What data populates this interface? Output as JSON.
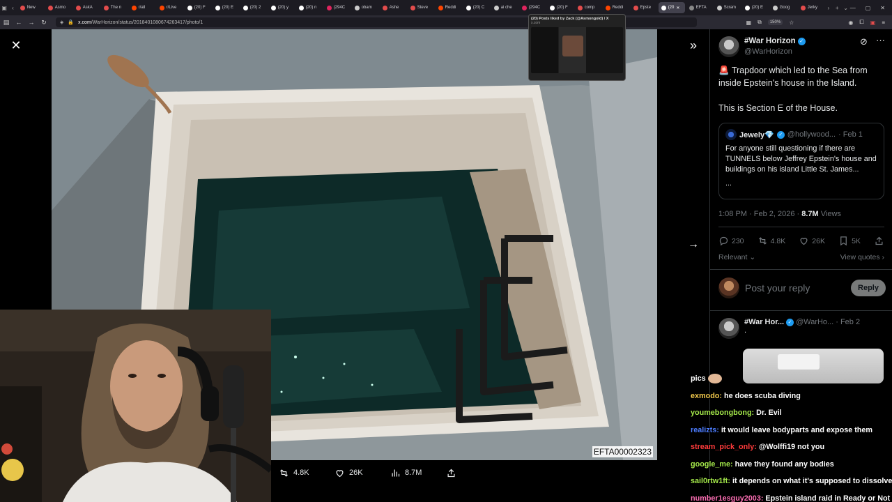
{
  "browser": {
    "tabs": [
      {
        "label": "New",
        "color": "#e34c4c"
      },
      {
        "label": "Asmo",
        "color": "#e34c4c"
      },
      {
        "label": "AskA",
        "color": "#e34c4c"
      },
      {
        "label": "The n",
        "color": "#e34c4c"
      },
      {
        "label": "r/all",
        "color": "#ff4500"
      },
      {
        "label": "r/Live",
        "color": "#ff4500"
      },
      {
        "label": "(20) F",
        "color": "#ffffff"
      },
      {
        "label": "(20) E",
        "color": "#ffffff"
      },
      {
        "label": "(20) 2",
        "color": "#ffffff"
      },
      {
        "label": "(20) y",
        "color": "#ffffff"
      },
      {
        "label": "(20) n",
        "color": "#ffffff"
      },
      {
        "label": "(294C",
        "color": "#e0245e"
      },
      {
        "label": "obam",
        "color": "#cccccc"
      },
      {
        "label": "Ashe",
        "color": "#e34c4c"
      },
      {
        "label": "Steve",
        "color": "#e34c4c"
      },
      {
        "label": "Reddi",
        "color": "#ff4500"
      },
      {
        "label": "(20) C",
        "color": "#ffffff"
      },
      {
        "label": "ai che",
        "color": "#cccccc"
      },
      {
        "label": "(294C",
        "color": "#e0245e"
      },
      {
        "label": "(20) F",
        "color": "#ffffff"
      },
      {
        "label": "comp",
        "color": "#e34c4c"
      },
      {
        "label": "Reddi",
        "color": "#ff4500"
      },
      {
        "label": "Epste",
        "color": "#e34c4c"
      },
      {
        "label": "(20",
        "color": "#ffffff"
      },
      {
        "label": "EFTA",
        "color": "#888888"
      },
      {
        "label": "Scram",
        "color": "#cccccc"
      },
      {
        "label": "(20) E",
        "color": "#ffffff"
      },
      {
        "label": "Goog",
        "color": "#cccccc"
      },
      {
        "label": "Jerky",
        "color": "#e34c4c"
      }
    ],
    "active_tab_index": 23,
    "url_host": "x.com",
    "url_path": "/WarHorizon/status/2018401080674263417/photo/1",
    "zoom": "150%",
    "preview": {
      "title": "(20) Posts liked by Zack (@Asmongold) / X",
      "host": "x.com"
    }
  },
  "photo": {
    "id_label": "EFTA00002323",
    "actions": {
      "retweets": "4.8K",
      "likes": "26K",
      "views": "8.7M"
    }
  },
  "tweet": {
    "author_name": "#War Horizon",
    "author_handle": "@WarHorizon",
    "text_line1": "Trapdoor which led to the Sea from inside Epstein's house in the Island.",
    "siren": "🚨",
    "text_line2": "This is Section E of the House.",
    "quote": {
      "name": "Jewely💎",
      "handle": "@hollywood...",
      "date": "· Feb 1",
      "text": "For anyone still questioning if there are TUNNELS below Jeffrey Epstein's house and buildings on his island Little St. James...",
      "ellipsis": "..."
    },
    "time": "1:08 PM · Feb 2, 2026 · ",
    "views_count": "8.7M",
    "views_label": " Views",
    "stats": {
      "replies": "230",
      "retweets": "4.8K",
      "likes": "26K",
      "bookmarks": "5K"
    },
    "relevant_label": "Relevant",
    "view_quotes_label": "View quotes",
    "reply_placeholder": "Post your reply",
    "reply_button": "Reply",
    "reply2": {
      "name": "#War Hor...",
      "handle": "@WarHo...",
      "date": "· Feb 2",
      "text": "."
    }
  },
  "chat": [
    {
      "user": "",
      "message": "pics",
      "user_color": "#ffffff",
      "emote": true
    },
    {
      "user": "exmodo:",
      "message": "he does scuba diving",
      "user_color": "#f2c94c"
    },
    {
      "user": "youmebongbong:",
      "message": "Dr. Evil",
      "user_color": "#a4e84a"
    },
    {
      "user": "realizts:",
      "message": "it would leave bodyparts and expose them",
      "user_color": "#4d7dff"
    },
    {
      "user": "stream_pick_only:",
      "message": "@Wolffi19 not you",
      "user_color": "#ff3b3b"
    },
    {
      "user": "google_me:",
      "message": "have they found any bodies",
      "user_color": "#a4e84a"
    },
    {
      "user": "sail0rtw1ft:",
      "message": "it depends on what it's supposed to dissolve",
      "user_color": "#a4e84a"
    },
    {
      "user": "number1esguy2003:",
      "message": "Epstein island raid in Ready or Not",
      "user_color": "#ff6fb5"
    }
  ]
}
